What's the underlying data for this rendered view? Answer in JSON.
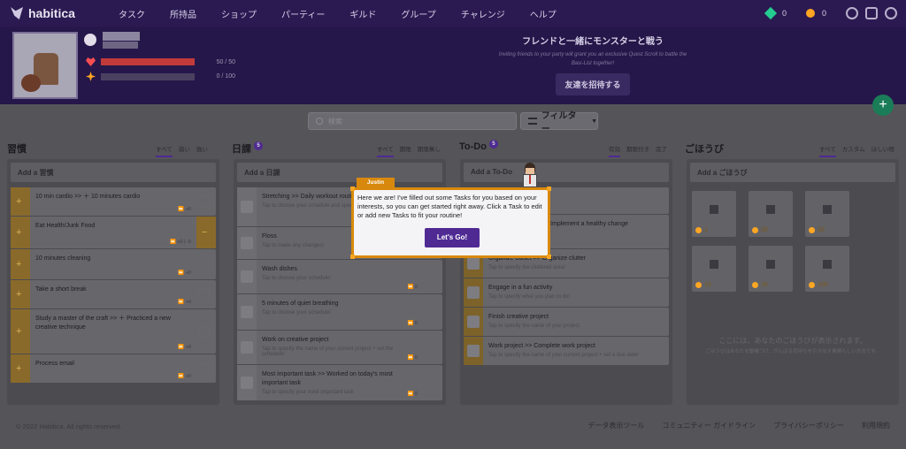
{
  "nav": {
    "logo": "habitica",
    "items": [
      "タスク",
      "所持品",
      "ショップ",
      "パーティー",
      "ギルド",
      "グループ",
      "チャレンジ",
      "ヘルプ"
    ],
    "gems": "0",
    "gold": "0"
  },
  "header": {
    "hp_text": "50 / 50",
    "hp_fraction": 1.0,
    "xp_text": "0 / 100",
    "xp_fraction": 0.0,
    "promo_title": "フレンドと一緒にモンスターと戦う",
    "promo_text": "Inviting friends to your party will grant you an exclusive Quest Scroll to battle the Basi-List together!",
    "promo_button": "友達を招待する"
  },
  "toolbar": {
    "search_placeholder": "検索",
    "filter_label": "フィルター"
  },
  "habits": {
    "title": "習慣",
    "tabs": [
      "すべて",
      "弱い",
      "強い"
    ],
    "add_label": "Add a 習慣",
    "items": [
      {
        "title": "10 min cardio >> ＋ 10 minutes cardio",
        "meta": "⏩ +0"
      },
      {
        "title": "Eat Health/Junk Food",
        "meta": "⏩ +0 | -0"
      },
      {
        "title": "10 minutes cleaning",
        "meta": "⏩ +0"
      },
      {
        "title": "Take a short break",
        "meta": "⏩ +0"
      },
      {
        "title": "Study a master of the craft >> ＋ Practiced a new creative technique",
        "meta": "⏩ +0"
      },
      {
        "title": "Process email",
        "meta": "⏩ +0"
      }
    ]
  },
  "dailies": {
    "title": "日課",
    "badge": "5",
    "tabs": [
      "すべて",
      "期限",
      "期限無し"
    ],
    "add_label": "Add a 日課",
    "items": [
      {
        "title": "Stretching >> Daily workout routine",
        "note": "Tap to choose your schedule and specify",
        "meta": ""
      },
      {
        "title": "Floss",
        "note": "Tap to make any changes!",
        "meta": ""
      },
      {
        "title": "Wash dishes",
        "note": "Tap to choose your schedule!",
        "meta": "⏩ 0"
      },
      {
        "title": "5 minutes of quiet breathing",
        "note": "Tap to choose your schedule!",
        "meta": "⏩ 0"
      },
      {
        "title": "Work on creative project",
        "note": "Tap to specify the name of your current project + set the schedule!",
        "meta": "⏩ 0"
      },
      {
        "title": "Most important task >> Worked on today's most important task",
        "note": "Tap to specify your most important task",
        "meta": "⏩ 0"
      }
    ]
  },
  "todos": {
    "title": "To-Do",
    "badge": "5",
    "tabs": [
      "有効",
      "期限付き",
      "完了"
    ],
    "add_label": "Add a To-Do",
    "items": [
      {
        "title": "",
        "note": "",
        "meta": ""
      },
      {
        "title": "Eat a healthy meal >> Implement a healthy change",
        "note": "",
        "meta": ""
      },
      {
        "title": "Organize closet >> Organize clutter",
        "note": "Tap to specify the cluttered area!",
        "meta": ""
      },
      {
        "title": "Engage in a fun activity",
        "note": "Tap to specify what you plan to do!",
        "meta": ""
      },
      {
        "title": "Finish creative project",
        "note": "Tap to specify the name of your project",
        "meta": ""
      },
      {
        "title": "Work project >> Complete work project",
        "note": "Tap to specify the name of your current project + set a due date!",
        "meta": ""
      }
    ]
  },
  "rewards": {
    "title": "ごほうび",
    "tabs": [
      "すべて",
      "カスタム",
      "ほしい物"
    ],
    "add_label": "Add a ごほうび",
    "items": [
      {
        "cost": "1"
      },
      {
        "cost": "20"
      },
      {
        "cost": "20"
      },
      {
        "cost": "15"
      },
      {
        "cost": "25"
      },
      {
        "cost": "100"
      }
    ],
    "empty_text": "ここには、あなたのごほうびが表示されます。",
    "empty_sub": "ごほうびはあなたを動機づけ、がんばる気持ちを引き出す素晴らしい方法です。"
  },
  "footer": {
    "copyright": "© 2022 Habitica. All rights reserved.",
    "links": [
      "データ表示ツール",
      "コミュニティー ガイドライン",
      "プライバシーポリシー",
      "利用規約"
    ]
  },
  "modal": {
    "speaker": "Justin",
    "text": "Here we are! I've filled out some Tasks for you based on your interests, so you can get started right away. Click a Task to edit or add new Tasks to fit your routine!",
    "button": "Let's Go!"
  },
  "colors": {
    "nav_bg": "#2b1a52",
    "accent_purple": "#4f2a93",
    "modal_border": "#d8890d",
    "hp_red": "#f74e52",
    "xp_gold": "#ffa623"
  }
}
